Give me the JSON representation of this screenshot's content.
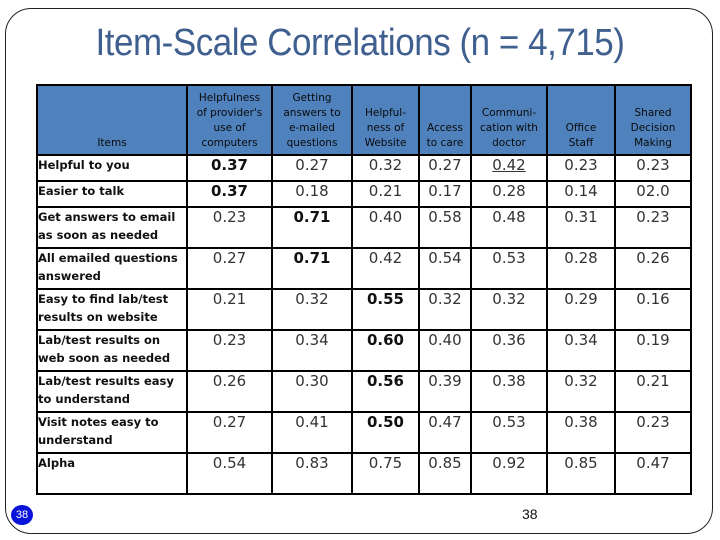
{
  "title": "Item-Scale Correlations (n = 4,715)",
  "table": {
    "items_header": "Items",
    "columns": [
      [
        "Helpfulness",
        "of provider's",
        "use of",
        "computers"
      ],
      [
        "Getting",
        "answers to",
        "e-mailed",
        "questions"
      ],
      [
        "Helpful-",
        "ness of",
        "Website"
      ],
      [
        "Access",
        "to care"
      ],
      [
        "Communi-",
        "cation with",
        "doctor"
      ],
      [
        "Office",
        "Staff"
      ],
      [
        "Shared",
        "Decision",
        "Making"
      ]
    ],
    "column_labels": [
      "Helpfulness of provider's use of computers",
      "Getting answers to e-mailed questions",
      "Helpful-ness of Website",
      "Access to care",
      "Communi-cation with doctor",
      "Office Staff",
      "Shared Decision Making"
    ],
    "rows": [
      {
        "item": [
          "Helpful to you"
        ],
        "values": [
          "0.37",
          "0.27",
          "0.32",
          "0.27",
          "0.42",
          "0.23",
          "0.23"
        ],
        "bold": [
          0
        ],
        "underline": [
          4
        ]
      },
      {
        "item": [
          "Easier to talk"
        ],
        "values": [
          "0.37",
          "0.18",
          "0.21",
          "0.17",
          "0.28",
          "0.14",
          "02.0"
        ],
        "bold": [
          0
        ],
        "underline": []
      },
      {
        "item": [
          "Get answers to email",
          "as soon as needed"
        ],
        "values": [
          "0.23",
          "0.71",
          "0.40",
          "0.58",
          "0.48",
          "0.31",
          "0.23"
        ],
        "bold": [
          1
        ],
        "underline": []
      },
      {
        "item": [
          "All emailed questions",
          "answered"
        ],
        "values": [
          "0.27",
          "0.71",
          "0.42",
          "0.54",
          "0.53",
          "0.28",
          "0.26"
        ],
        "bold": [
          1
        ],
        "underline": []
      },
      {
        "item": [
          "Easy to find lab/test",
          "results on website"
        ],
        "values": [
          "0.21",
          "0.32",
          "0.55",
          "0.32",
          "0.32",
          "0.29",
          "0.16"
        ],
        "bold": [
          2
        ],
        "underline": []
      },
      {
        "item": [
          "Lab/test results on",
          "web soon as needed"
        ],
        "values": [
          "0.23",
          "0.34",
          "0.60",
          "0.40",
          "0.36",
          "0.34",
          "0.19"
        ],
        "bold": [
          2
        ],
        "underline": []
      },
      {
        "item": [
          "Lab/test results easy",
          "to understand"
        ],
        "values": [
          "0.26",
          "0.30",
          "0.56",
          "0.39",
          "0.38",
          "0.32",
          "0.21"
        ],
        "bold": [
          2
        ],
        "underline": []
      },
      {
        "item": [
          "Visit notes easy to",
          "understand"
        ],
        "values": [
          "0.27",
          "0.41",
          "0.50",
          "0.47",
          "0.53",
          "0.38",
          "0.23"
        ],
        "bold": [
          2
        ],
        "underline": []
      },
      {
        "item": [
          "Alpha"
        ],
        "values": [
          "0.54",
          "0.83",
          "0.75",
          "0.85",
          "0.92",
          "0.85",
          "0.47"
        ],
        "bold": [],
        "underline": []
      }
    ]
  },
  "footer": {
    "badge_number": "38",
    "page_number": "38"
  },
  "colors": {
    "title": "#3f5f8f",
    "header_bg": "#4f81bd",
    "badge_bg": "#0a14d8"
  }
}
